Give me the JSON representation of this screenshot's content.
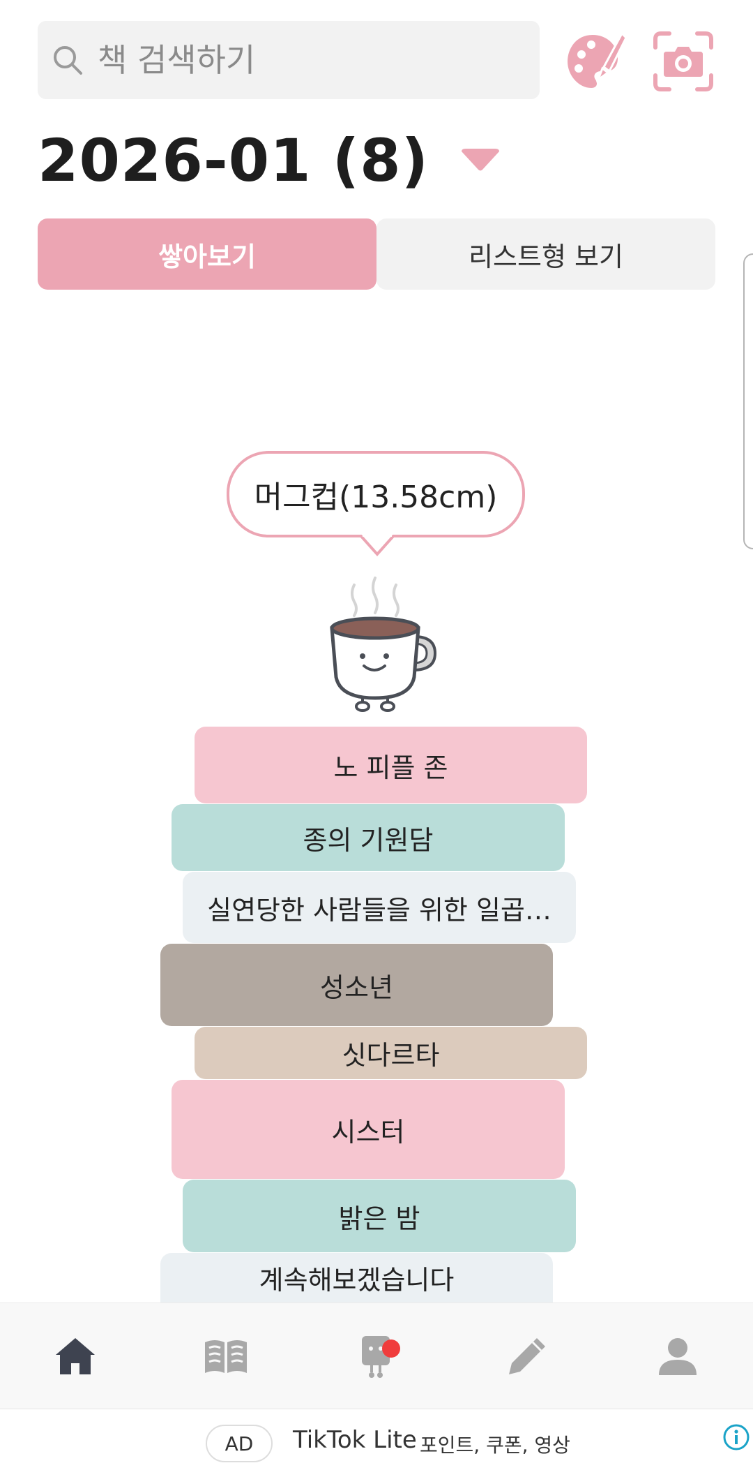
{
  "search": {
    "placeholder": "책 검색하기"
  },
  "header": {
    "month_title": "2026-01 (8)"
  },
  "tabs": [
    {
      "label": "쌓아보기",
      "active": true
    },
    {
      "label": "리스트형 보기",
      "active": false
    }
  ],
  "stack": {
    "tooltip": "머그컵(13.58cm)",
    "books": [
      {
        "title": "노 피플 존",
        "color": "#f6c6d0"
      },
      {
        "title": "종의 기원담",
        "color": "#b9ddd9"
      },
      {
        "title": "실연당한 사람들을 위한 일곱…",
        "color": "#ebf0f3"
      },
      {
        "title": "성소년",
        "color": "#b2a8a0"
      },
      {
        "title": "싯다르타",
        "color": "#dccbbd"
      },
      {
        "title": "시스터",
        "color": "#f6c6d0"
      },
      {
        "title": "밝은 밤",
        "color": "#b9ddd9"
      },
      {
        "title": "계속해보겠습니다",
        "color": "#ebf0f3"
      }
    ]
  },
  "nav": {
    "items": [
      "home-icon",
      "book-icon",
      "robot-icon",
      "pencil-icon",
      "profile-icon"
    ],
    "active_item": "home-icon",
    "notification_on": "robot-icon"
  },
  "ad": {
    "badge": "AD",
    "title": "TikTok Lite",
    "subtitle": "포인트, 쿠폰, 영상"
  },
  "colors": {
    "accent": "#eca5b3",
    "nav_active": "#3e4350",
    "nav_inactive": "#a8a8a8",
    "notification": "#f03c3c"
  }
}
